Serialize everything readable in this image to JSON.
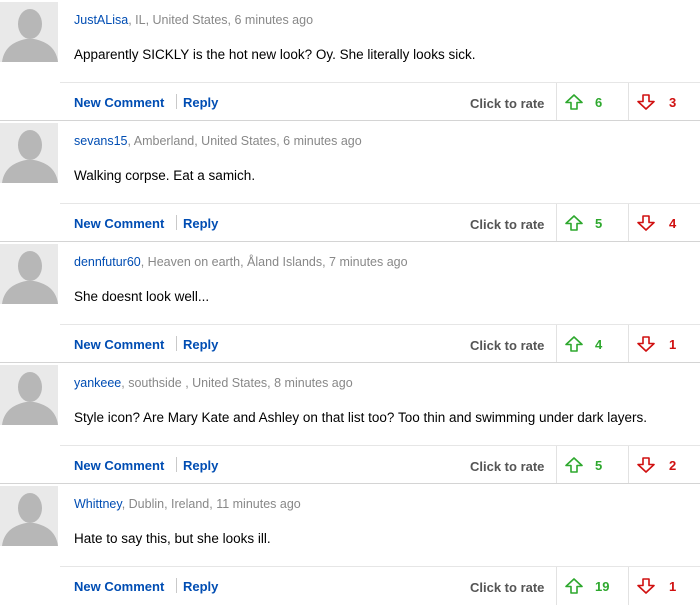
{
  "colors": {
    "username": "#004db3",
    "up": "#2ea82e",
    "down": "#d01010"
  },
  "labels": {
    "new_comment": "New Comment",
    "reply": "Reply",
    "rate": "Click to rate"
  },
  "comments": [
    {
      "user": "JustALisa",
      "location": ", IL, United States, 6 minutes ago",
      "text": "Apparently SICKLY is the hot new look? Oy. She literally looks sick.",
      "up": "6",
      "down": "3"
    },
    {
      "user": "sevans15",
      "location": ", Amberland, United States, 6 minutes ago",
      "text": "Walking corpse. Eat a samich.",
      "up": "5",
      "down": "4"
    },
    {
      "user": "dennfutur60",
      "location": ", Heaven on earth, Åland Islands, 7 minutes ago",
      "text": "She doesnt look well...",
      "up": "4",
      "down": "1"
    },
    {
      "user": "yankeee",
      "location": ", southside , United States, 8 minutes ago",
      "text": "Style icon? Are Mary Kate and Ashley on that list too? Too thin and swimming under dark layers.",
      "up": "5",
      "down": "2"
    },
    {
      "user": "Whittney",
      "location": ", Dublin, Ireland, 11 minutes ago",
      "text": "Hate to say this, but she looks ill.",
      "up": "19",
      "down": "1"
    }
  ]
}
